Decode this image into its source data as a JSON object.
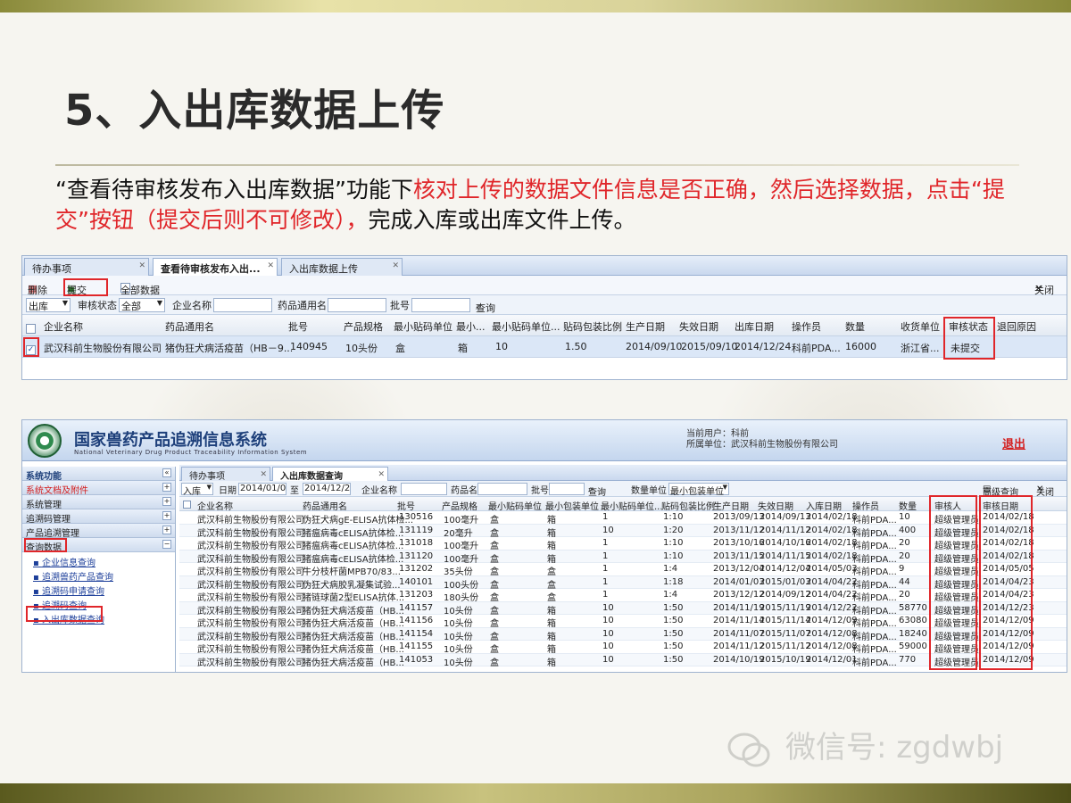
{
  "slide": {
    "title": "5、入出库数据上传",
    "desc_prefix": "“查看待审核发布入出库数据”功能下",
    "desc_red": "核对上传的数据文件信息是否正确，然后选择数据，点击“提交”按钮（提交后则不可修改），",
    "desc_suffix": "完成入库或出库文件上传。"
  },
  "shot1": {
    "tabs": [
      "待办事项",
      "查看待审核发布入出...",
      "入出库数据上传"
    ],
    "toolbar": {
      "delete": "删除",
      "submit": "提交",
      "select_all": "全部数据",
      "close": "关闭"
    },
    "filter": {
      "direction": "出库",
      "status_label": "审核状态",
      "status_value": "全部",
      "company_label": "企业名称",
      "drug_label": "药品通用名",
      "batch_label": "批号",
      "query": "查询"
    },
    "headers": [
      "企业名称",
      "药品通用名",
      "批号",
      "产品规格",
      "最小贴码单位",
      "最小...",
      "最小贴码单位...",
      "贴码包装比例",
      "生产日期",
      "失效日期",
      "出库日期",
      "操作员",
      "数量",
      "收货单位",
      "审核状态",
      "退回原因"
    ],
    "row": [
      "武汉科前生物股份有限公司",
      "猪伪狂犬病活疫苗（HB－9...",
      "140945",
      "10头份",
      "盒",
      "箱",
      "10",
      "1.50",
      "2014/09/10",
      "2015/09/10",
      "2014/12/24",
      "科前PDA...",
      "16000",
      "浙江省...",
      "未提交",
      ""
    ]
  },
  "shot2": {
    "system_name": "国家兽药产品追溯信息系统",
    "system_eng": "National Veterinary Drug Product Traceability Information System",
    "user_line1": "当前用户：科前",
    "user_line2": "所属单位：武汉科前生物股份有限公司",
    "logout": "退出",
    "side": {
      "groups": [
        "系统功能",
        "系统文档及附件",
        "系统管理",
        "追溯码管理",
        "产品追溯管理",
        "查询数据"
      ],
      "items": [
        "企业信息查询",
        "追溯兽药产品查询",
        "追溯码申请查询",
        "追溯码查询",
        "入出库数据查询"
      ]
    },
    "tabs": [
      "待办事项",
      "入出库数据查询"
    ],
    "filter": {
      "direction": "入库",
      "date_label": "日期",
      "date_from": "2014/01/0",
      "date_to": "2014/12/2",
      "to": "至",
      "company_label": "企业名称",
      "drug_label": "药品名",
      "batch_label": "批号",
      "query": "查询",
      "qty_label": "数量单位",
      "qty_value": "最小包装单位",
      "adv": "高级查询",
      "close": "关闭"
    },
    "headers": [
      "企业名称",
      "药品通用名",
      "批号",
      "产品规格",
      "最小贴码单位",
      "最小包装单位",
      "最小贴码单位...",
      "贴码包装比例",
      "生产日期",
      "失效日期",
      "入库日期",
      "操作员",
      "数量",
      "审核人",
      "审核日期"
    ],
    "rows": [
      [
        "武汉科前生物股份有限公司",
        "伪狂犬病gE-ELISA抗体检...",
        "130516",
        "100毫升",
        "盒",
        "箱",
        "1",
        "1:10",
        "2013/09/13",
        "2014/09/13",
        "2014/02/18",
        "科前PDA...",
        "10",
        "超级管理员",
        "2014/02/18"
      ],
      [
        "武汉科前生物股份有限公司",
        "猪瘟病毒cELISA抗体检...",
        "131119",
        "20毫升",
        "盒",
        "箱",
        "10",
        "1:20",
        "2013/11/12",
        "2014/11/12",
        "2014/02/18",
        "科前PDA...",
        "400",
        "超级管理员",
        "2014/02/18"
      ],
      [
        "武汉科前生物股份有限公司",
        "猪瘟病毒cELISA抗体检...",
        "131018",
        "100毫升",
        "盒",
        "箱",
        "1",
        "1:10",
        "2013/10/16",
        "2014/10/16",
        "2014/02/18",
        "科前PDA...",
        "20",
        "超级管理员",
        "2014/02/18"
      ],
      [
        "武汉科前生物股份有限公司",
        "猪瘟病毒cELISA抗体检...",
        "131120",
        "100毫升",
        "盒",
        "箱",
        "1",
        "1:10",
        "2013/11/15",
        "2014/11/15",
        "2014/02/18",
        "科前PDA...",
        "20",
        "超级管理员",
        "2014/02/18"
      ],
      [
        "武汉科前生物股份有限公司",
        "牛分枝杆菌MPB70/83...",
        "131202",
        "35头份",
        "盒",
        "盒",
        "1",
        "1:4",
        "2013/12/04",
        "2014/12/04",
        "2014/05/03",
        "科前PDA...",
        "9",
        "超级管理员",
        "2014/05/05"
      ],
      [
        "武汉科前生物股份有限公司",
        "伪狂犬病胶乳凝集试验...",
        "140101",
        "100头份",
        "盒",
        "盒",
        "1",
        "1:18",
        "2014/01/03",
        "2015/01/03",
        "2014/04/22",
        "科前PDA...",
        "44",
        "超级管理员",
        "2014/04/23"
      ],
      [
        "武汉科前生物股份有限公司",
        "猪链球菌2型ELISA抗体...",
        "131203",
        "180头份",
        "盒",
        "盒",
        "1",
        "1:4",
        "2013/12/12",
        "2014/09/12",
        "2014/04/22",
        "科前PDA...",
        "20",
        "超级管理员",
        "2014/04/23"
      ],
      [
        "武汉科前生物股份有限公司",
        "猪伪狂犬病活疫苗（HB...",
        "141157",
        "10头份",
        "盒",
        "箱",
        "10",
        "1:50",
        "2014/11/19",
        "2015/11/19",
        "2014/12/22",
        "科前PDA...",
        "58770",
        "超级管理员",
        "2014/12/23"
      ],
      [
        "武汉科前生物股份有限公司",
        "猪伪狂犬病活疫苗（HB...",
        "141156",
        "10头份",
        "盒",
        "箱",
        "10",
        "1:50",
        "2014/11/14",
        "2015/11/14",
        "2014/12/09",
        "科前PDA...",
        "63080",
        "超级管理员",
        "2014/12/09"
      ],
      [
        "武汉科前生物股份有限公司",
        "猪伪狂犬病活疫苗（HB...",
        "141154",
        "10头份",
        "盒",
        "箱",
        "10",
        "1:50",
        "2014/11/07",
        "2015/11/07",
        "2014/12/08",
        "科前PDA...",
        "18240",
        "超级管理员",
        "2014/12/09"
      ],
      [
        "武汉科前生物股份有限公司",
        "猪伪狂犬病活疫苗（HB...",
        "141155",
        "10头份",
        "盒",
        "箱",
        "10",
        "1:50",
        "2014/11/12",
        "2015/11/12",
        "2014/12/08",
        "科前PDA...",
        "59000",
        "超级管理员",
        "2014/12/09"
      ],
      [
        "武汉科前生物股份有限公司",
        "猪伪狂犬病活疫苗（HB...",
        "141053",
        "10头份",
        "盒",
        "箱",
        "10",
        "1:50",
        "2014/10/19",
        "2015/10/19",
        "2014/12/01",
        "科前PDA...",
        "770",
        "超级管理员",
        "2014/12/09"
      ]
    ]
  },
  "watermark": "微信号: zgdwbj"
}
